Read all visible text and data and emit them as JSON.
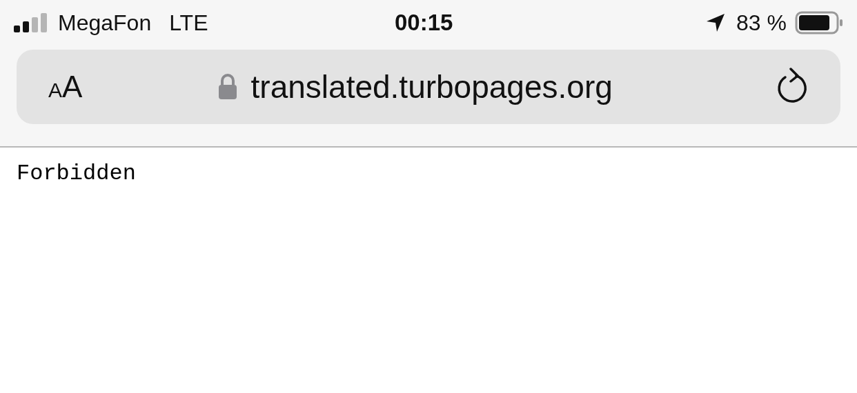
{
  "status_bar": {
    "carrier": "MegaFon",
    "network": "LTE",
    "time": "00:15",
    "battery": "83 %"
  },
  "address_bar": {
    "text_size_button": [
      "A",
      "A"
    ],
    "url": "translated.turbopages.org"
  },
  "page": {
    "text": "Forbidden"
  }
}
